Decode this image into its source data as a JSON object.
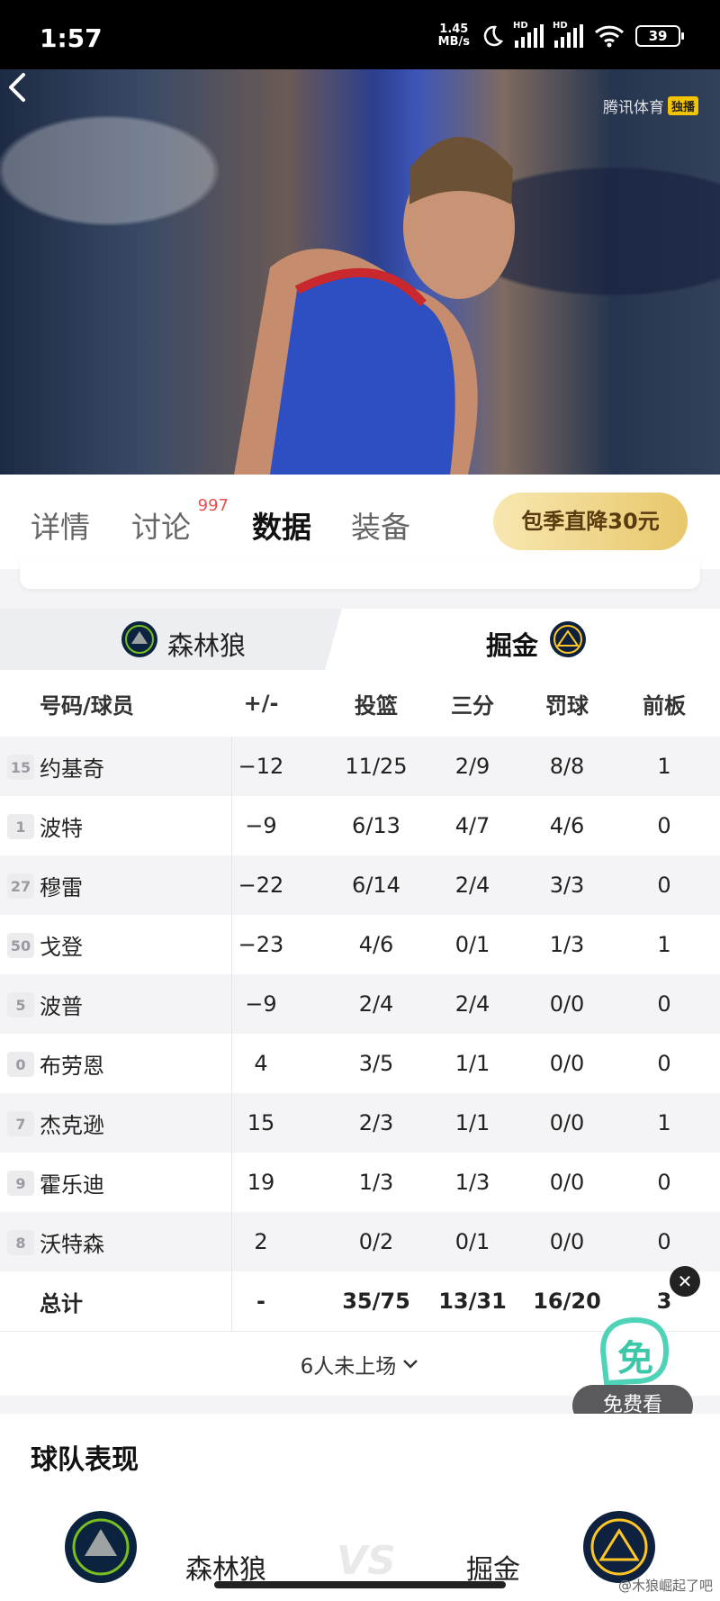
{
  "status_bar": {
    "time": "1:57",
    "net_speed_value": "1.45",
    "net_speed_unit": "MB/s",
    "hd_label": "HD",
    "battery": "39"
  },
  "video": {
    "watermark": "腾讯体育",
    "exclusive_badge": "独播"
  },
  "tabs": [
    {
      "label": "详情",
      "active": false
    },
    {
      "label": "讨论",
      "badge": "997",
      "active": false
    },
    {
      "label": "数据",
      "active": true
    },
    {
      "label": "装备",
      "active": false
    }
  ],
  "promo_button": "包季直降30元",
  "team_switch": {
    "left": "森林狼",
    "right": "掘金",
    "active": "掘金"
  },
  "table": {
    "headers": [
      "号码/球员",
      "+/-",
      "投篮",
      "三分",
      "罚球",
      "前板"
    ],
    "rows": [
      {
        "num": "15",
        "name": "约基奇",
        "pm": "−12",
        "fg": "11/25",
        "tp": "2/9",
        "ft": "8/8",
        "oreb": "1"
      },
      {
        "num": "1",
        "name": "波特",
        "pm": "−9",
        "fg": "6/13",
        "tp": "4/7",
        "ft": "4/6",
        "oreb": "0"
      },
      {
        "num": "27",
        "name": "穆雷",
        "pm": "−22",
        "fg": "6/14",
        "tp": "2/4",
        "ft": "3/3",
        "oreb": "0"
      },
      {
        "num": "50",
        "name": "戈登",
        "pm": "−23",
        "fg": "4/6",
        "tp": "0/1",
        "ft": "1/3",
        "oreb": "1"
      },
      {
        "num": "5",
        "name": "波普",
        "pm": "−9",
        "fg": "2/4",
        "tp": "2/4",
        "ft": "0/0",
        "oreb": "0"
      },
      {
        "num": "0",
        "name": "布劳恩",
        "pm": "4",
        "fg": "3/5",
        "tp": "1/1",
        "ft": "0/0",
        "oreb": "0"
      },
      {
        "num": "7",
        "name": "杰克逊",
        "pm": "15",
        "fg": "2/3",
        "tp": "1/1",
        "ft": "0/0",
        "oreb": "1"
      },
      {
        "num": "9",
        "name": "霍乐迪",
        "pm": "19",
        "fg": "1/3",
        "tp": "1/3",
        "ft": "0/0",
        "oreb": "0"
      },
      {
        "num": "8",
        "name": "沃特森",
        "pm": "2",
        "fg": "0/2",
        "tp": "0/1",
        "ft": "0/0",
        "oreb": "0"
      }
    ],
    "total": {
      "label": "总计",
      "pm": "-",
      "fg": "35/75",
      "tp": "13/31",
      "ft": "16/20",
      "oreb": "3"
    },
    "more_label": "6人未上场"
  },
  "floating": {
    "close": "✕",
    "icon_char": "免",
    "button": "免费看"
  },
  "team_performance": {
    "title": "球队表现",
    "left_team": "森林狼",
    "vs": "VS",
    "right_team": "掘金"
  },
  "credit": "@木狼崛起了吧",
  "colors": {
    "promo_gold": "#e8c76a",
    "badge_red": "#e94d4d",
    "nuggets_navy": "#0e2240",
    "wolves_navy": "#0c2340"
  }
}
